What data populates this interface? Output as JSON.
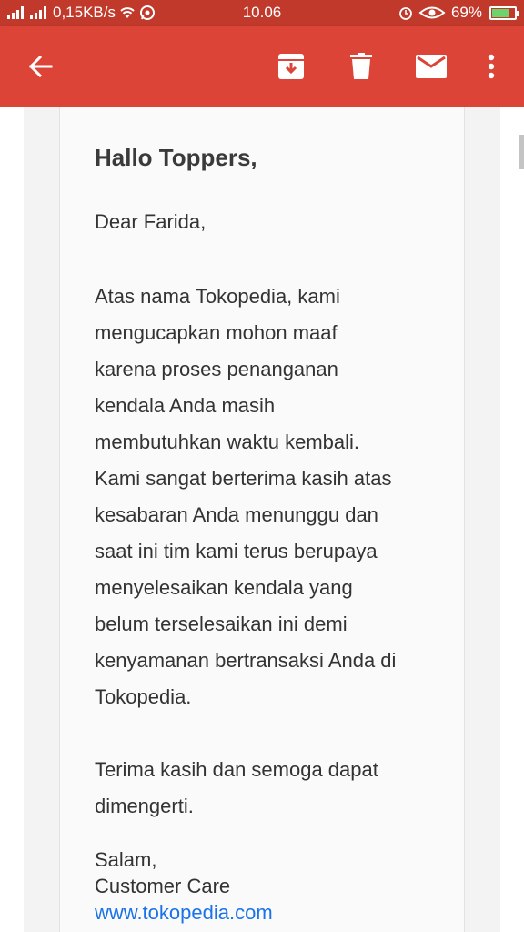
{
  "status_bar": {
    "network_speed": "0,15KB/s",
    "time": "10.06",
    "battery": "69%",
    "battery_level": 0.69
  },
  "toolbar": {
    "back_icon": "arrow-left-icon",
    "archive_icon": "archive-icon",
    "delete_icon": "trash-icon",
    "mail_icon": "mail-icon",
    "more_icon": "more-vert-icon"
  },
  "email": {
    "greeting": "Hallo Toppers,",
    "salutation": "Dear Farida,",
    "body_lines": [
      "Atas nama Tokopedia, kami",
      "mengucapkan mohon maaf",
      "karena proses penanganan",
      "kendala Anda masih",
      "membutuhkan waktu kembali.",
      "Kami sangat berterima kasih atas",
      "kesabaran Anda menunggu dan",
      "saat ini tim kami terus berupaya",
      "menyelesaikan kendala yang",
      "belum terselesaikan ini demi",
      "kenyamanan bertransaksi Anda di",
      "Tokopedia."
    ],
    "closing_lines": [
      "Terima kasih dan semoga dapat",
      "dimengerti."
    ],
    "signoff": "Salam,",
    "sender": "Customer Care",
    "link": "www.tokopedia.com"
  },
  "colors": {
    "status_bar": "#c0392b",
    "app_bar": "#db4437",
    "link": "#1a73e8"
  }
}
